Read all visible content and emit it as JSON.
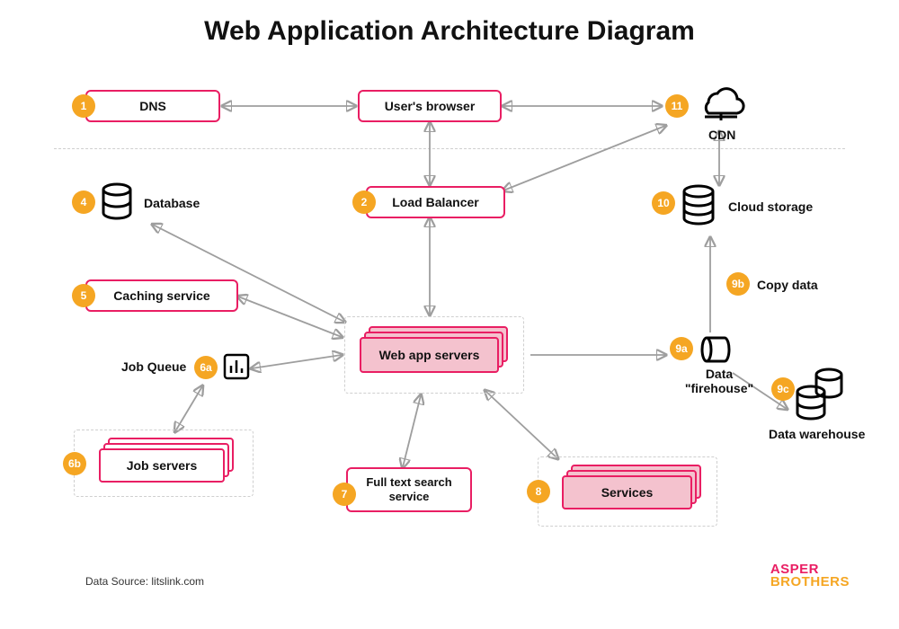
{
  "title": "Web Application Architecture Diagram",
  "source": "Data Source: litslink.com",
  "logo": {
    "line1": "ASPER",
    "line2": "BROTHERS"
  },
  "nodes": {
    "dns": {
      "num": "1",
      "label": "DNS"
    },
    "browser": {
      "label": "User's browser"
    },
    "cdn": {
      "num": "11",
      "label": "CDN"
    },
    "lb": {
      "num": "2",
      "label": "Load Balancer"
    },
    "db": {
      "num": "4",
      "label": "Database"
    },
    "cache": {
      "num": "5",
      "label": "Caching service"
    },
    "jobq": {
      "num": "6a",
      "label": "Job Queue"
    },
    "jobsrv": {
      "num": "6b",
      "label": "Job servers"
    },
    "search": {
      "num": "7",
      "label": "Full text search service"
    },
    "webapp": {
      "label": "Web app servers"
    },
    "services": {
      "num": "8",
      "label": "Services"
    },
    "firehose": {
      "num": "9a",
      "label": "Data \"firehouse\""
    },
    "copydata": {
      "num": "9b",
      "label": "Copy data"
    },
    "warehouse": {
      "num": "9c",
      "label": "Data warehouse"
    },
    "cloudstor": {
      "num": "10",
      "label": "Cloud storage"
    }
  }
}
